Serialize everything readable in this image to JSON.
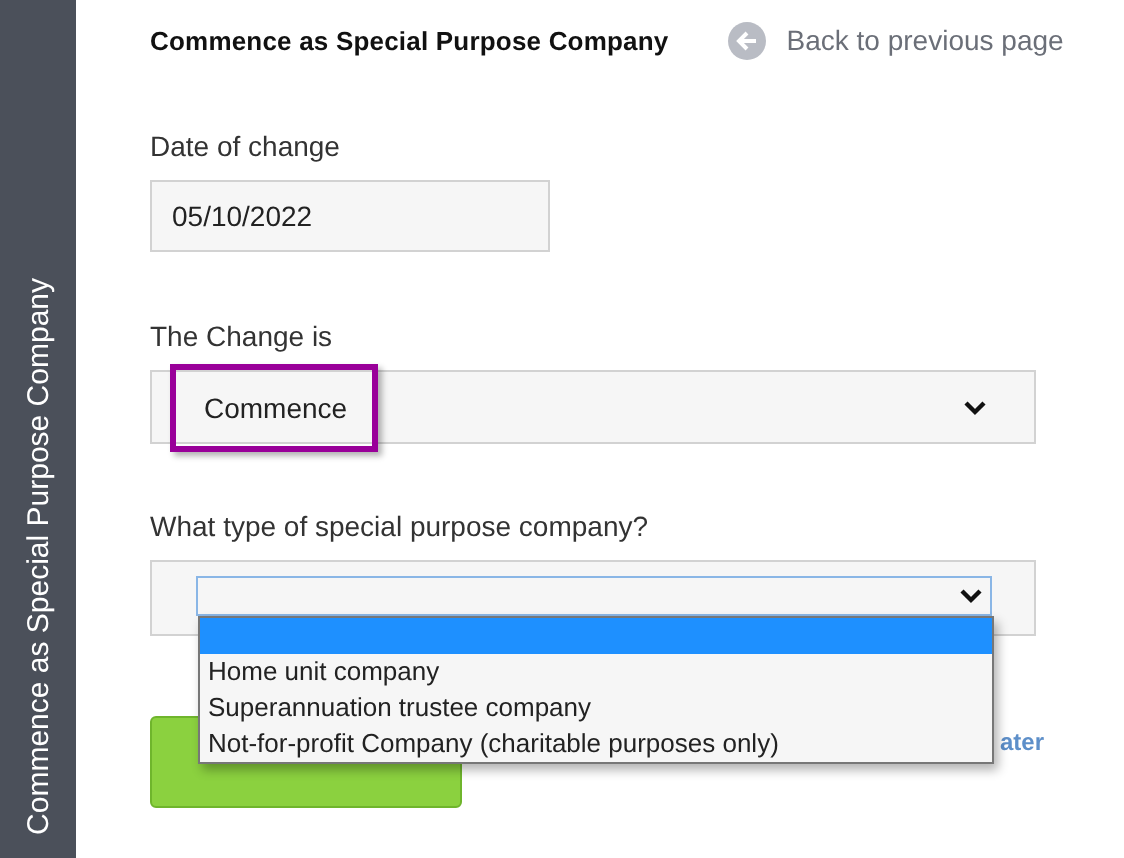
{
  "sidebar": {
    "title": "Commence as Special Purpose Company"
  },
  "header": {
    "title": "Commence as Special Purpose Company",
    "back_link": "Back to previous page"
  },
  "date_field": {
    "label": "Date of change",
    "value": "05/10/2022"
  },
  "change_field": {
    "label": "The Change is",
    "value": "Commence",
    "highlighted": true
  },
  "type_field": {
    "label": "What type of special purpose company?",
    "open": true,
    "blank_option_selected": true,
    "options": [
      {
        "label": "Home unit company",
        "selected": false
      },
      {
        "label": "Superannuation trustee company",
        "selected": false
      },
      {
        "label": "Not-for-profit Company (charitable purposes only)",
        "selected": false
      }
    ]
  },
  "later_link": {
    "label": "ater"
  }
}
